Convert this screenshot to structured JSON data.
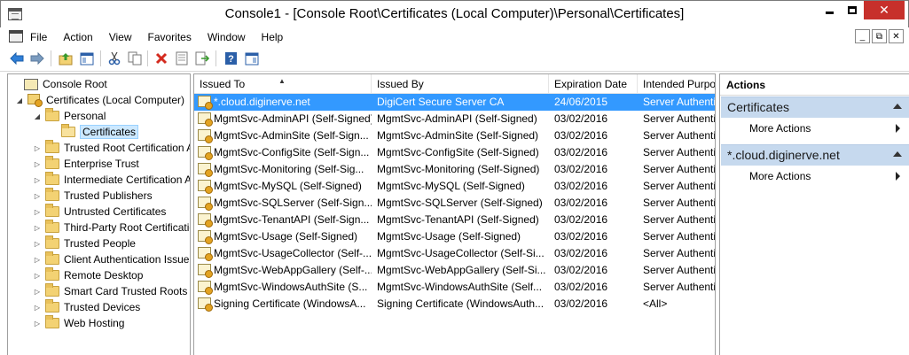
{
  "window": {
    "title": "Console1 - [Console Root\\Certificates (Local Computer)\\Personal\\Certificates]",
    "min_label": "",
    "max_label": "",
    "close_label": "✕"
  },
  "menubar": {
    "items": [
      "File",
      "Action",
      "View",
      "Favorites",
      "Window",
      "Help"
    ],
    "mdi": [
      "_",
      "⧉",
      "✕"
    ]
  },
  "toolbar": {
    "buttons": [
      "back-icon",
      "forward-icon",
      "up-folder-icon",
      "show-hide-tree-icon",
      "cut-icon",
      "copy-icon",
      "delete-icon",
      "properties-icon",
      "export-icon",
      "help-icon",
      "show-hide-action-pane-icon"
    ]
  },
  "tree": {
    "items": [
      {
        "label": "Console Root",
        "level": 0,
        "arrow": "",
        "icon": "console"
      },
      {
        "label": "Certificates (Local Computer)",
        "level": 1,
        "arrow": "◢",
        "icon": "certstore"
      },
      {
        "label": "Personal",
        "level": 2,
        "arrow": "◢",
        "icon": "folder"
      },
      {
        "label": "Certificates",
        "level": 3,
        "arrow": "",
        "icon": "folder-open",
        "selected": true
      },
      {
        "label": "Trusted Root Certification Autho",
        "level": 2,
        "arrow": "▷",
        "icon": "folder"
      },
      {
        "label": "Enterprise Trust",
        "level": 2,
        "arrow": "▷",
        "icon": "folder"
      },
      {
        "label": "Intermediate Certification Autho",
        "level": 2,
        "arrow": "▷",
        "icon": "folder"
      },
      {
        "label": "Trusted Publishers",
        "level": 2,
        "arrow": "▷",
        "icon": "folder"
      },
      {
        "label": "Untrusted Certificates",
        "level": 2,
        "arrow": "▷",
        "icon": "folder"
      },
      {
        "label": "Third-Party Root Certification A",
        "level": 2,
        "arrow": "▷",
        "icon": "folder"
      },
      {
        "label": "Trusted People",
        "level": 2,
        "arrow": "▷",
        "icon": "folder"
      },
      {
        "label": "Client Authentication Issuers",
        "level": 2,
        "arrow": "▷",
        "icon": "folder"
      },
      {
        "label": "Remote Desktop",
        "level": 2,
        "arrow": "▷",
        "icon": "folder"
      },
      {
        "label": "Smart Card Trusted Roots",
        "level": 2,
        "arrow": "▷",
        "icon": "folder"
      },
      {
        "label": "Trusted Devices",
        "level": 2,
        "arrow": "▷",
        "icon": "folder"
      },
      {
        "label": "Web Hosting",
        "level": 2,
        "arrow": "▷",
        "icon": "folder"
      }
    ]
  },
  "list": {
    "columns": [
      "Issued To",
      "Issued By",
      "Expiration Date",
      "Intended Purpo"
    ],
    "sort_indicator": "▲",
    "rows": [
      {
        "issued_to": "*.cloud.diginerve.net",
        "issued_by": "DigiCert Secure Server CA",
        "expiration": "24/06/2015",
        "purpose": "Server Authenti",
        "selected": true
      },
      {
        "issued_to": "MgmtSvc-AdminAPI (Self-Signed)",
        "issued_by": "MgmtSvc-AdminAPI (Self-Signed)",
        "expiration": "03/02/2016",
        "purpose": "Server Authenti"
      },
      {
        "issued_to": "MgmtSvc-AdminSite (Self-Sign...",
        "issued_by": "MgmtSvc-AdminSite (Self-Signed)",
        "expiration": "03/02/2016",
        "purpose": "Server Authenti"
      },
      {
        "issued_to": "MgmtSvc-ConfigSite (Self-Sign...",
        "issued_by": "MgmtSvc-ConfigSite (Self-Signed)",
        "expiration": "03/02/2016",
        "purpose": "Server Authenti"
      },
      {
        "issued_to": "MgmtSvc-Monitoring (Self-Sig...",
        "issued_by": "MgmtSvc-Monitoring (Self-Signed)",
        "expiration": "03/02/2016",
        "purpose": "Server Authenti"
      },
      {
        "issued_to": "MgmtSvc-MySQL (Self-Signed)",
        "issued_by": "MgmtSvc-MySQL (Self-Signed)",
        "expiration": "03/02/2016",
        "purpose": "Server Authenti"
      },
      {
        "issued_to": "MgmtSvc-SQLServer (Self-Sign...",
        "issued_by": "MgmtSvc-SQLServer (Self-Signed)",
        "expiration": "03/02/2016",
        "purpose": "Server Authenti"
      },
      {
        "issued_to": "MgmtSvc-TenantAPI (Self-Sign...",
        "issued_by": "MgmtSvc-TenantAPI (Self-Signed)",
        "expiration": "03/02/2016",
        "purpose": "Server Authenti"
      },
      {
        "issued_to": "MgmtSvc-Usage (Self-Signed)",
        "issued_by": "MgmtSvc-Usage (Self-Signed)",
        "expiration": "03/02/2016",
        "purpose": "Server Authenti"
      },
      {
        "issued_to": "MgmtSvc-UsageCollector (Self-...",
        "issued_by": "MgmtSvc-UsageCollector (Self-Si...",
        "expiration": "03/02/2016",
        "purpose": "Server Authenti"
      },
      {
        "issued_to": "MgmtSvc-WebAppGallery (Self-...",
        "issued_by": "MgmtSvc-WebAppGallery (Self-Si...",
        "expiration": "03/02/2016",
        "purpose": "Server Authenti"
      },
      {
        "issued_to": "MgmtSvc-WindowsAuthSite (S...",
        "issued_by": "MgmtSvc-WindowsAuthSite (Self...",
        "expiration": "03/02/2016",
        "purpose": "Server Authenti"
      },
      {
        "issued_to": "Signing Certificate (WindowsA...",
        "issued_by": "Signing Certificate (WindowsAuth...",
        "expiration": "03/02/2016",
        "purpose": "<All>"
      }
    ]
  },
  "actions": {
    "title": "Actions",
    "sections": [
      {
        "label": "Certificates",
        "items": [
          "More Actions"
        ]
      },
      {
        "label": "*.cloud.diginerve.net",
        "items": [
          "More Actions"
        ]
      }
    ]
  }
}
